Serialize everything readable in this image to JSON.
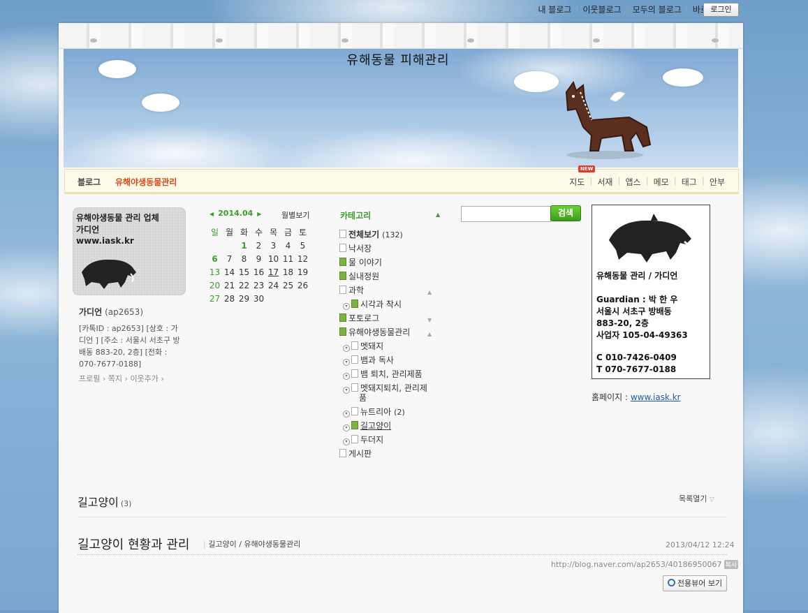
{
  "topbar": {
    "links": [
      "내 블로그",
      "이웃블로그",
      "모두의 블로그",
      "바로가기"
    ],
    "login": "로그인"
  },
  "header": {
    "blog_title": "유해동물 피해관리"
  },
  "nav": {
    "left_blog": "블로그",
    "left_name": "유해야생동물관리",
    "new_badge": "NEW",
    "right": [
      "지도",
      "서재",
      "앱스",
      "메모",
      "태그",
      "안부"
    ]
  },
  "profile": {
    "image_lines": [
      "유해야생동물 관리 업체",
      "가디언",
      "www.iask.kr"
    ],
    "name": "가디언",
    "id": "(ap2653)",
    "desc": "[카톡ID : ap2653] [상호 : 가디언 ] [주소 : 서울시 서초구 방배동 883-20, 2층] [전화 : 070-7677-0188]",
    "links": [
      "프로필",
      "쪽지",
      "이웃추가"
    ]
  },
  "calendar": {
    "month": "2014.04",
    "monthly_view": "월별보기",
    "weekdays": [
      "일",
      "월",
      "화",
      "수",
      "목",
      "금",
      "토"
    ],
    "weeks": [
      [
        "",
        "",
        "1",
        "2",
        "3",
        "4",
        "5"
      ],
      [
        "6",
        "7",
        "8",
        "9",
        "10",
        "11",
        "12"
      ],
      [
        "13",
        "14",
        "15",
        "16",
        "17",
        "18",
        "19"
      ],
      [
        "20",
        "21",
        "22",
        "23",
        "24",
        "25",
        "26"
      ],
      [
        "27",
        "28",
        "29",
        "30",
        "",
        "",
        ""
      ]
    ]
  },
  "category": {
    "title": "카테고리",
    "all": "전체보기",
    "all_count": "(132)",
    "items": [
      {
        "label": "낙서장"
      },
      {
        "label": "물 이야기"
      },
      {
        "label": "실내정원"
      },
      {
        "label": "과학"
      },
      {
        "label": "시각과 착시"
      },
      {
        "label": "포토로그"
      },
      {
        "label": "유해야생동물관리"
      },
      {
        "label": "멧돼지"
      },
      {
        "label": "뱀과 독사"
      },
      {
        "label": "뱀 퇴치, 관리제품"
      },
      {
        "label": "멧돼지퇴치, 관리제"
      },
      {
        "label": "품"
      },
      {
        "label": "뉴트리아",
        "count": "(2)"
      },
      {
        "label": "길고양이"
      },
      {
        "label": "두더지"
      },
      {
        "label": "게시판"
      }
    ]
  },
  "search": {
    "placeholder": "",
    "button": "검색"
  },
  "widget": {
    "lines": [
      "유해동물 관리 / 가디언",
      "Guardian :  박 한 우",
      "서울시 서초구 방배동",
      "883-20, 2층",
      "사업자 105-04-49363",
      "C 010-7426-0409",
      "T 070-7677-0188"
    ],
    "homepage_label": "홈페이지 :",
    "homepage_url": "www.iask.kr"
  },
  "post_list": {
    "category_name": "길고양이",
    "count": "(3)",
    "list_open": "목록열기"
  },
  "post": {
    "title": "길고양이 현황과 관리",
    "categories": "길고양이 / 유해야생동물관리",
    "date": "2013/04/12 12:24",
    "url": "http://blog.naver.com/ap2653/40186950067",
    "copy_label": "복사",
    "viewer_button": "전용뷰어 보기"
  }
}
